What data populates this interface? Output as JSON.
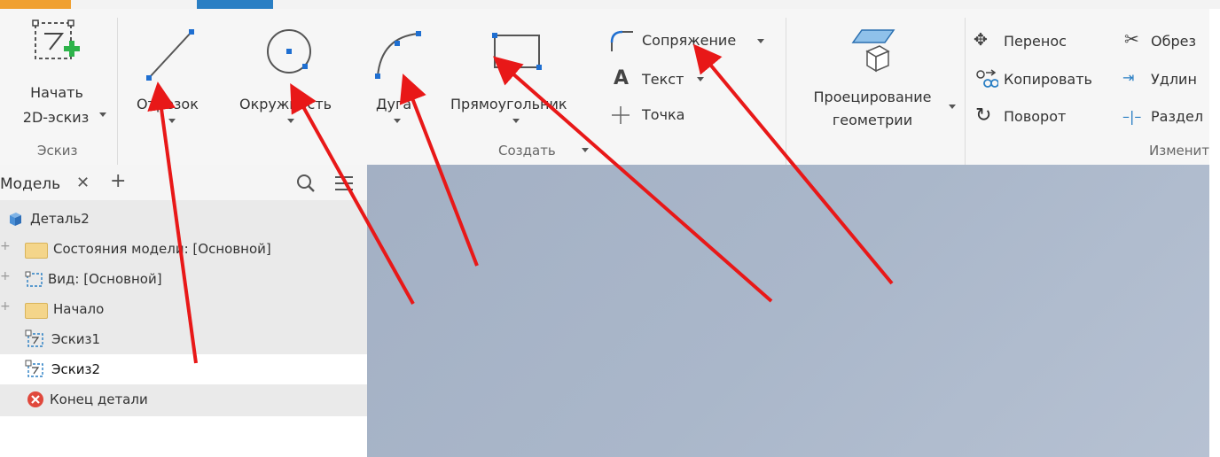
{
  "ribbon": {
    "start_sketch": {
      "line1": "Начать",
      "line2": "2D-эскиз",
      "group": "Эскиз"
    },
    "create_tools": {
      "line": "Отрезок",
      "circle": "Окружность",
      "arc": "Дуга",
      "rectangle": "Прямоугольник",
      "fillet": "Сопряжение",
      "text": "Текст",
      "point": "Точка",
      "group": "Создать"
    },
    "project": {
      "line1": "Проецирование",
      "line2": "геометрии"
    },
    "modify": {
      "move": "Перенос",
      "copy": "Копировать",
      "rotate": "Поворот",
      "trim": "Обрез",
      "extend": "Удлин",
      "split": "Раздел",
      "group": "Изменит"
    }
  },
  "browser": {
    "tab_label": "Модель",
    "close_glyph": "✕",
    "add_glyph": "+",
    "tree": [
      {
        "label": "Деталь2"
      },
      {
        "label": "Состояния модели: [Основной]"
      },
      {
        "label": "Вид: [Основной]"
      },
      {
        "label": "Начало"
      },
      {
        "label": "Эскиз1"
      },
      {
        "label": "Эскиз2"
      },
      {
        "label": "Конец детали"
      }
    ]
  },
  "colors": {
    "accent": "#2a7fc4",
    "arrow": "#e81818",
    "viewport": "#a9b5c8",
    "icon_blue": "#1f6fd1"
  }
}
